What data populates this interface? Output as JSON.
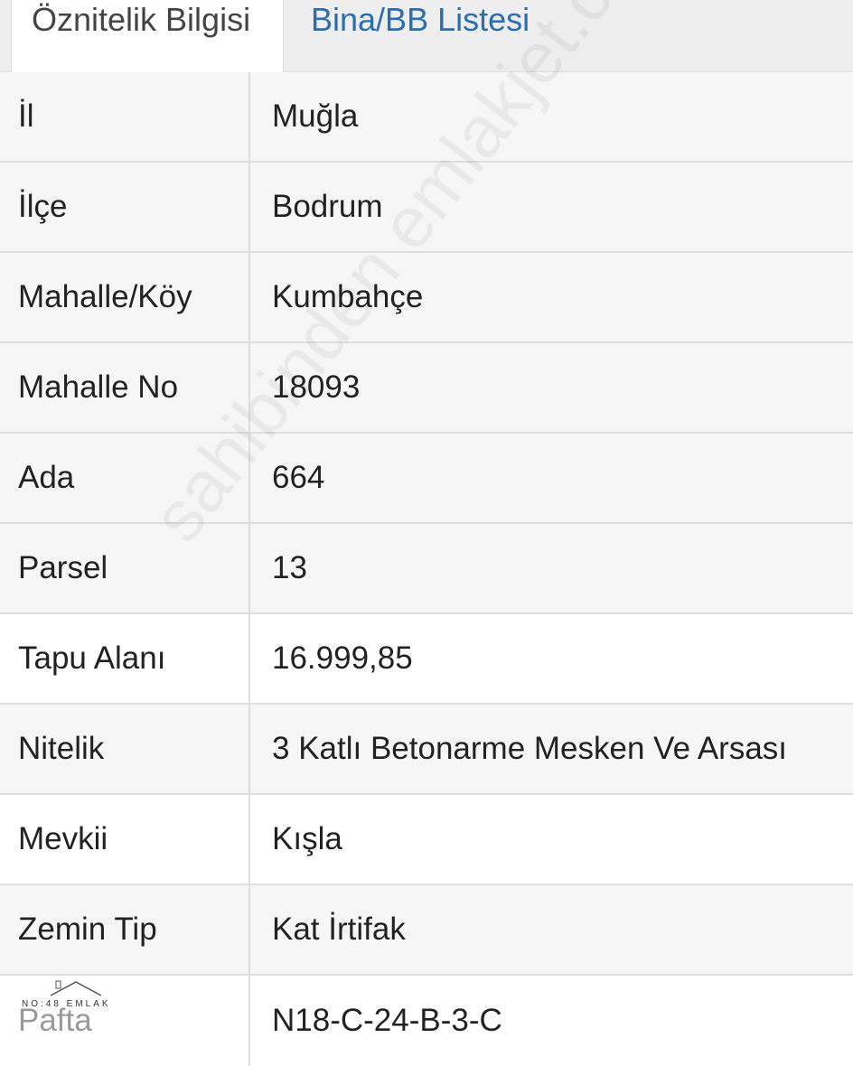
{
  "tabs": [
    {
      "label": "Öznitelik Bilgisi",
      "active": true
    },
    {
      "label": "Bina/BB Listesi",
      "active": false
    }
  ],
  "rows": [
    {
      "label": "İl",
      "value": "Muğla"
    },
    {
      "label": "İlçe",
      "value": "Bodrum"
    },
    {
      "label": "Mahalle/Köy",
      "value": "Kumbahçe"
    },
    {
      "label": "Mahalle No",
      "value": "18093"
    },
    {
      "label": "Ada",
      "value": "664"
    },
    {
      "label": "Parsel",
      "value": "13"
    },
    {
      "label": "Tapu Alanı",
      "value": "16.999,85"
    },
    {
      "label": "Nitelik",
      "value": "3 Katlı Betonarme Mesken Ve Arsası"
    },
    {
      "label": "Mevkii",
      "value": "Kışla"
    },
    {
      "label": "Zemin Tip",
      "value": "Kat İrtifak"
    },
    {
      "label": "Pafta",
      "value": "N18-C-24-B-3-C"
    }
  ],
  "watermark": "sahibinden emlakjet.com",
  "logo": {
    "text": "NO:48 EMLAK"
  },
  "colors": {
    "tab_link": "#2a6db0",
    "row_alt": "#f6f6f6",
    "border": "#dedede"
  }
}
